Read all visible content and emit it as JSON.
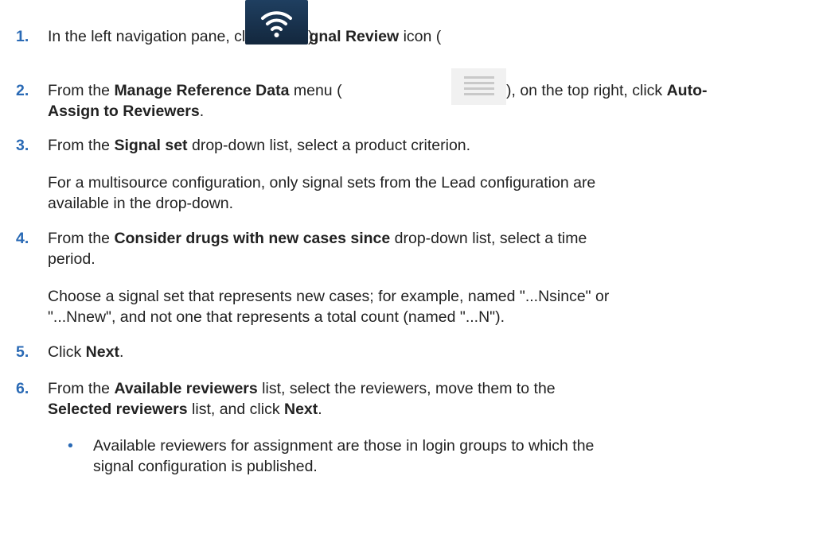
{
  "steps": [
    {
      "number": "1.",
      "pre": "In the left navigation pane, click the ",
      "bold": "Signal Review",
      "mid": " icon (",
      "post": ")."
    },
    {
      "number": "2.",
      "pre": "From the ",
      "bold": "Manage Reference Data",
      "mid": " menu (",
      "post": "), on the top right, click ",
      "bold2_a": "Auto-",
      "bold2_b": "Assign to Reviewers",
      "end": "."
    },
    {
      "number": "3.",
      "pre": "From the ",
      "bold": "Signal set",
      "post": " drop-down list, select a product criterion.",
      "note_line1": "For a multisource configuration, only signal sets from the Lead configuration are",
      "note_line2": "available in the drop-down."
    },
    {
      "number": "4.",
      "pre": "From the ",
      "bold": "Consider drugs with new cases since",
      "post": " drop-down list, select a time",
      "line2": "period.",
      "note_line1": "Choose a signal set that represents new cases; for example, named \"...Nsince\" or",
      "note_line2": "\"...Nnew\", and not one that represents a total count (named \"...N\")."
    },
    {
      "number": "5.",
      "pre": "Click ",
      "bold": "Next",
      "post": "."
    },
    {
      "number": "6.",
      "pre": "From the ",
      "bold": "Available reviewers",
      "post": " list, select the reviewers, move them to the",
      "bold_b": "Selected reviewers",
      "post_b": " list, and click ",
      "bold_c": "Next",
      "end": ".",
      "bullet": "•",
      "sub_line1": "Available reviewers for assignment are those in login groups to which the",
      "sub_line2": "signal configuration is published."
    }
  ],
  "icons": {
    "signal_review": "wifi-icon",
    "manage_reference_data": "hamburger-menu-icon"
  },
  "colors": {
    "step_number": "#2a6ab5",
    "signal_icon_bg": "#1f3f60",
    "menu_icon_bg": "#f1f1f1"
  }
}
